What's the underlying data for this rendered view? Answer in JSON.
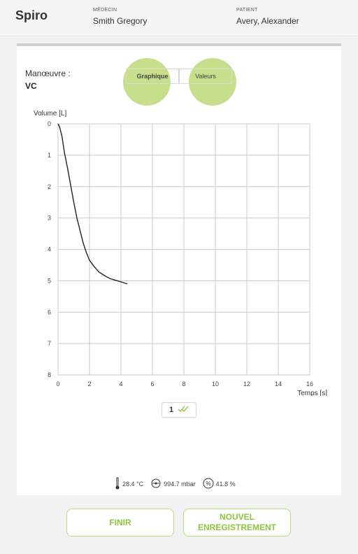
{
  "header": {
    "app_title": "Spiro",
    "doctor_caption": "MÉDECIN",
    "doctor_name": "Smith Gregory",
    "patient_caption": "PATIENT",
    "patient_name": "Avery, Alexander"
  },
  "maneuvre": {
    "label": "Manœuvre :",
    "value": "VC"
  },
  "view_toggle": {
    "graph_label": "Graphique",
    "values_label": "Valeurs",
    "selected": "Graphique"
  },
  "chart_data": {
    "type": "line",
    "ylabel": "Volume [L]",
    "xlabel": "Temps [s]",
    "xlim": [
      0,
      16
    ],
    "ylim": [
      0,
      8
    ],
    "y_inverted": true,
    "x_ticks": [
      "0",
      "2",
      "4",
      "6",
      "8",
      "10",
      "12",
      "14",
      "16"
    ],
    "y_ticks": [
      "0",
      "1",
      "2",
      "3",
      "4",
      "5",
      "6",
      "7",
      "8"
    ],
    "grid": true,
    "series": [
      {
        "x": [
          0,
          0.1,
          0.25,
          0.4,
          0.6,
          0.8,
          1.0,
          1.2,
          1.4,
          1.6,
          1.8,
          2.0,
          2.3,
          2.6,
          3.0,
          3.3,
          3.7,
          4.1,
          4.4
        ],
        "y": [
          0,
          0.1,
          0.4,
          0.9,
          1.4,
          1.95,
          2.5,
          3.0,
          3.4,
          3.8,
          4.1,
          4.35,
          4.55,
          4.72,
          4.85,
          4.93,
          4.99,
          5.05,
          5.1
        ]
      }
    ]
  },
  "recording": {
    "number": "1",
    "check_icon": "double-check-icon"
  },
  "environment": {
    "temperature": "28.4 °C",
    "pressure": "994.7 mbar",
    "humidity": "41.8 %"
  },
  "actions": {
    "finish_label": "FINIR",
    "new_record_line1": "NOUVEL",
    "new_record_line2": "ENREGISTREMENT"
  },
  "colors": {
    "accent": "#8cc53f",
    "halo": "#afd25a"
  }
}
